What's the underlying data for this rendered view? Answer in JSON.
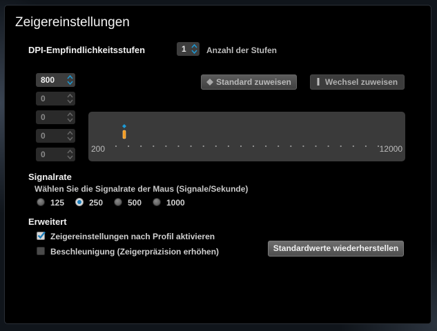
{
  "window": {
    "title": "Zeigereinstellungen"
  },
  "dpi": {
    "heading": "DPI-Empfindlichkeitsstufen",
    "levels_count": "1",
    "levels_label": "Anzahl der Stufen",
    "stages": [
      "800",
      "0",
      "0",
      "0",
      "0"
    ],
    "assign_default_label": "Standard zuweisen",
    "assign_switch_label": "Wechsel zuweisen",
    "slider": {
      "min_label": "200",
      "max_label": "12000",
      "min": 200,
      "max": 12000,
      "value": 800
    }
  },
  "polling": {
    "heading": "Signalrate",
    "description": "Wählen Sie die Signalrate der Maus (Signale/Sekunde)",
    "options": [
      "125",
      "250",
      "500",
      "1000"
    ],
    "selected": "250"
  },
  "advanced": {
    "heading": "Erweitert",
    "profile_settings_label": "Zeigereinstellungen nach Profil aktivieren",
    "profile_settings_checked": true,
    "acceleration_label": "Beschleunigung (Zeigerpräzision erhöhen)",
    "acceleration_checked": false,
    "restore_defaults_label": "Standardwerte wiederherstellen"
  },
  "colors": {
    "accent_blue": "#1d9ad6",
    "marker_orange": "#f39a1e",
    "checkmark_blue": "#1d7fbd"
  }
}
